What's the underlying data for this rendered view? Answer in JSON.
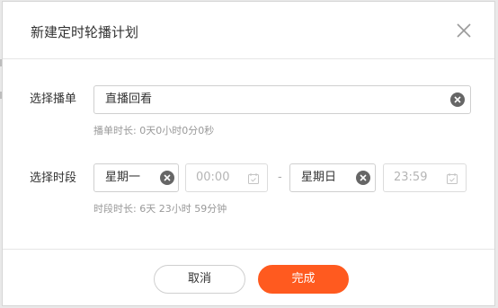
{
  "dialog": {
    "title": "新建定时轮播计划",
    "accent_color": "#ff5a1f"
  },
  "playlist": {
    "label": "选择播单",
    "value": "直播回看",
    "duration_text": "播单时长: 0天0小时0分0秒"
  },
  "period": {
    "label": "选择时段",
    "start_day": "星期一",
    "start_time_placeholder": "00:00",
    "separator": "-",
    "end_day": "星期日",
    "end_time_placeholder": "23:59",
    "duration_text": "时段时长: 6天 23小时 59分钟"
  },
  "footer": {
    "cancel_label": "取消",
    "confirm_label": "完成"
  }
}
